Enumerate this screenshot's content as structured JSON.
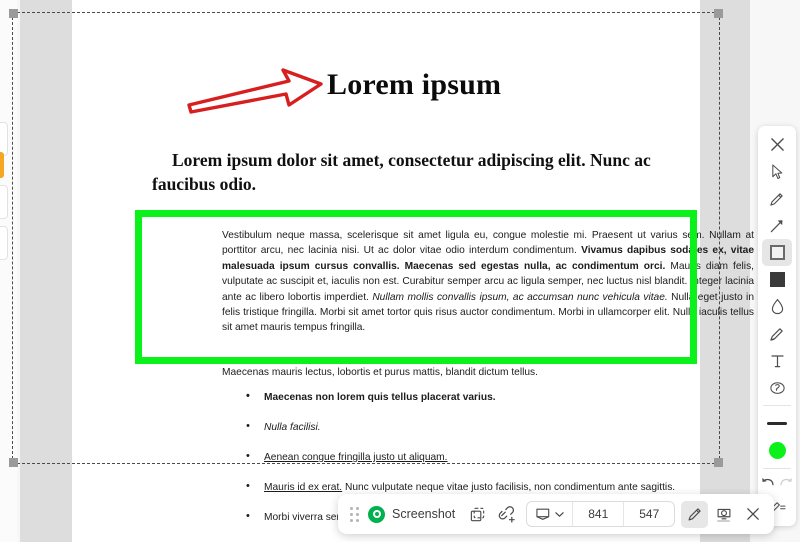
{
  "document": {
    "title": "Lorem ipsum",
    "subtitle": "Lorem ipsum dolor sit amet, consectetur adipiscing elit. Nunc ac faucibus odio.",
    "paragraph_runs": [
      {
        "text": "Vestibulum neque massa, scelerisque sit amet ligula eu, congue molestie mi. Praesent ut varius sem. Nullam at porttitor arcu, nec lacinia nisi. Ut ac dolor vitae odio interdum condimentum. ",
        "style": "normal"
      },
      {
        "text": "Vivamus dapibus sodales ex, vitae malesuada ipsum cursus convallis. Maecenas sed egestas nulla, ac condimentum orci.",
        "style": "bold"
      },
      {
        "text": " Mauris diam felis, vulputate ac suscipit et, iaculis non est. Curabitur semper arcu ac ligula semper, nec luctus nisl blandit. Integer lacinia ante ac libero lobortis imperdiet. ",
        "style": "normal"
      },
      {
        "text": "Nullam mollis convallis ipsum, ac accumsan nunc vehicula vitae.",
        "style": "italic"
      },
      {
        "text": " Nulla eget justo in felis tristique fringilla. Morbi sit amet tortor quis risus auctor condimentum. Morbi in ullamcorper elit. Nulla iaculis tellus sit amet mauris tempus fringilla.",
        "style": "normal"
      }
    ],
    "after_paragraph": "Maecenas mauris lectus, lobortis et purus mattis, blandit dictum tellus.",
    "bullets": [
      {
        "text": "Maecenas non lorem quis tellus placerat varius.",
        "style": "bold"
      },
      {
        "text": "Nulla facilisi.",
        "style": "italic"
      },
      {
        "text": "Aenean congue fringilla justo ut aliquam. ",
        "style": "underline"
      },
      {
        "lead": "Mauris id ex erat.",
        "text": " Nunc vulputate neque vitae justo facilisis, non condimentum ante sagittis.",
        "style": "lead-underline"
      },
      {
        "text": "Morbi viverra semper lorem n",
        "style": "normal"
      }
    ]
  },
  "annotations": {
    "arrow": {
      "name": "red-arrow",
      "color": "#d81f1f"
    },
    "highlight_box": {
      "name": "green-rectangle",
      "color": "#0bf21a"
    }
  },
  "tool_rail": {
    "items": [
      {
        "name": "close-icon",
        "label": "Close"
      },
      {
        "name": "cursor-select-icon",
        "label": "Select"
      },
      {
        "name": "pencil-draw-icon",
        "label": "Draw"
      },
      {
        "name": "arrow-tool-icon",
        "label": "Arrow"
      },
      {
        "name": "rectangle-tool-icon",
        "label": "Rectangle",
        "active": true
      },
      {
        "name": "fill-color-icon",
        "label": "Fill"
      },
      {
        "name": "blur-drop-icon",
        "label": "Blur"
      },
      {
        "name": "highlighter-icon",
        "label": "Highlighter"
      },
      {
        "name": "text-tool-icon",
        "label": "Text"
      },
      {
        "name": "stamp-number-icon",
        "label": "Step number"
      }
    ],
    "stroke_swatch": {
      "name": "stroke-width-swatch",
      "color": "#2b2b2b"
    },
    "color_swatch": {
      "name": "color-swatch",
      "color": "#0bf21a"
    },
    "undo": {
      "name": "undo-icon",
      "label": "Undo"
    },
    "redo": {
      "name": "redo-icon",
      "label": "Redo"
    },
    "settings": {
      "name": "pen-settings-icon",
      "label": "Settings"
    }
  },
  "recorder_bar": {
    "drag_handle": "drag-handle",
    "mode_label": "Screenshot",
    "copy_label": "Copy",
    "link_label": "Get link",
    "capture_area_label": "Capture area",
    "width": "841",
    "height": "547",
    "annotate_label": "Annotate",
    "camera_label": "Camera",
    "close_label": "Close"
  }
}
